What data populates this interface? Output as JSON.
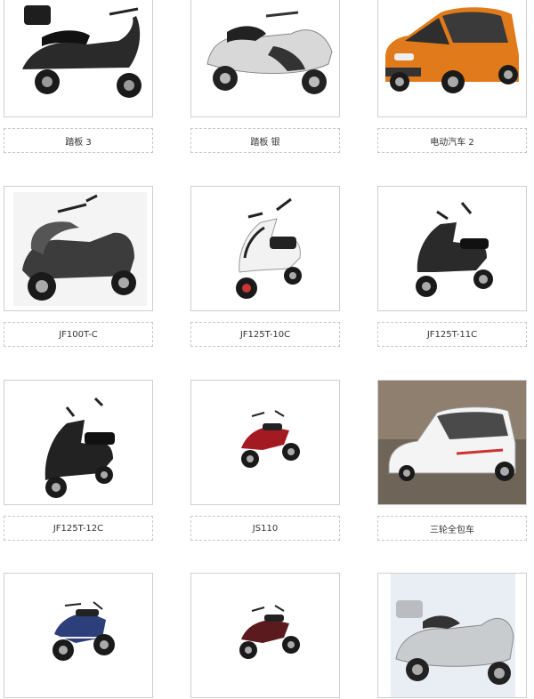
{
  "products": [
    {
      "name": "踏板 3",
      "icon": "scooter-black-topcase-icon"
    },
    {
      "name": "踏板 银",
      "icon": "scooter-silver-icon"
    },
    {
      "name": "电动汽车 2",
      "icon": "electric-car-orange-icon"
    },
    {
      "name": "JF100T-C",
      "icon": "scooter-grey-icon"
    },
    {
      "name": "JF125T-10C",
      "icon": "scooter-white-icon"
    },
    {
      "name": "JF125T-11C",
      "icon": "scooter-black-icon"
    },
    {
      "name": "JF125T-12C",
      "icon": "scooter-black-icon"
    },
    {
      "name": "JS110",
      "icon": "underbone-motorcycle-red-icon"
    },
    {
      "name": "三轮全包车",
      "icon": "enclosed-tricycle-white-icon"
    },
    {
      "name": "",
      "icon": "sport-motorcycle-blue-icon"
    },
    {
      "name": "",
      "icon": "underbone-motorcycle-red-icon"
    },
    {
      "name": "",
      "icon": "maxi-scooter-silver-icon"
    }
  ],
  "colors": {
    "border": "#cfcfcf",
    "caption_border": "#c8c8c8",
    "car_orange": "#e07a1a",
    "bike_red": "#a41a22"
  }
}
